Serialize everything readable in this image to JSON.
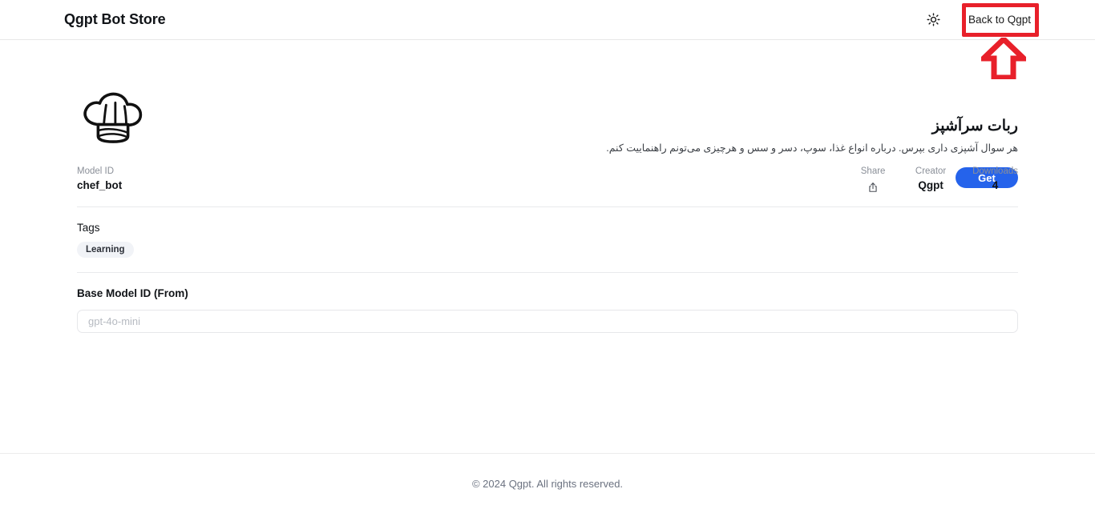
{
  "header": {
    "brand": "Qgpt Bot Store",
    "theme_toggle_icon": "sun-icon",
    "back_button": "Back to Qgpt"
  },
  "annotation": {
    "color": "#e8202a",
    "shape": "arrow-up",
    "target": "Back to Qgpt"
  },
  "hero": {
    "logo_icon": "chef-hat-icon",
    "title": "ربات سرآشپز",
    "description": "هر سوال آشپزی داری بپرس. درباره انواع غذا، سوپ، دسر و سس و هرچیزی می‌تونم راهنماییت کنم.",
    "get_button": "Get",
    "accent_color": "#2563eb"
  },
  "meta": {
    "model_id_label": "Model ID",
    "model_id_value": "chef_bot",
    "stats": [
      {
        "label": "Share",
        "value": "",
        "icon": "share-icon"
      },
      {
        "label": "Creator",
        "value": "Qgpt",
        "icon": ""
      },
      {
        "label": "Downloads",
        "value": "4",
        "icon": ""
      }
    ]
  },
  "tags": {
    "heading": "Tags",
    "items": [
      "Learning"
    ]
  },
  "base_model": {
    "label": "Base Model ID (From)",
    "placeholder": "gpt-4o-mini",
    "value": ""
  },
  "footer": {
    "text": "© 2024 Qgpt. All rights reserved."
  }
}
